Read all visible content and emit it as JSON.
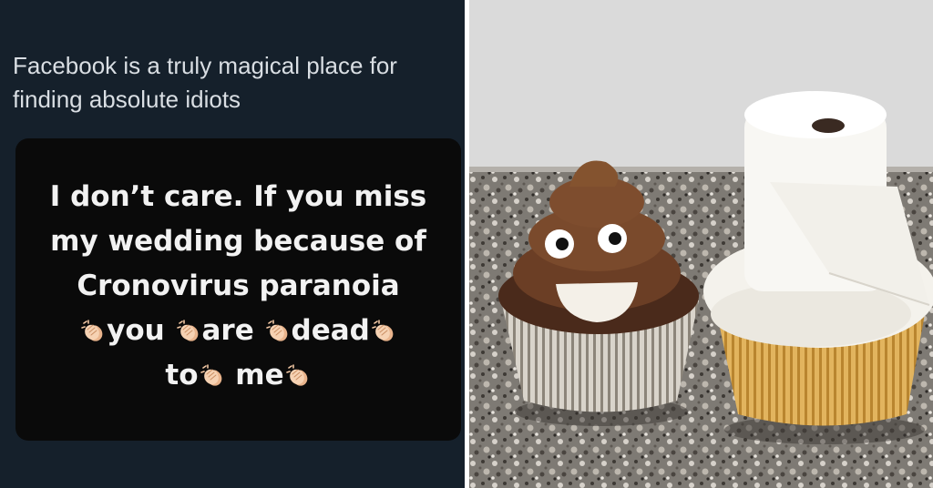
{
  "tweet": {
    "text_line1": "Facebook is a truly magical place for",
    "text_line2": "finding absolute idiots"
  },
  "story": {
    "line1": "I don’t care. If you miss",
    "line2": "my wedding because of",
    "line3": "Cronovirus paranoia",
    "line4_words": [
      "you",
      "are",
      "dead"
    ],
    "line5_words": [
      "to",
      "me"
    ],
    "emoji": "clapping-hands-icon"
  },
  "photo": {
    "subject": [
      "poop-emoji-cupcake",
      "toilet-paper-cupcake"
    ]
  },
  "colors": {
    "tweet_bg": "#15202b",
    "card_bg": "#0a0a0a",
    "tweet_text": "#d9dee3",
    "story_text": "#f2f2f2",
    "clap_skin": "#f3c8a4"
  }
}
